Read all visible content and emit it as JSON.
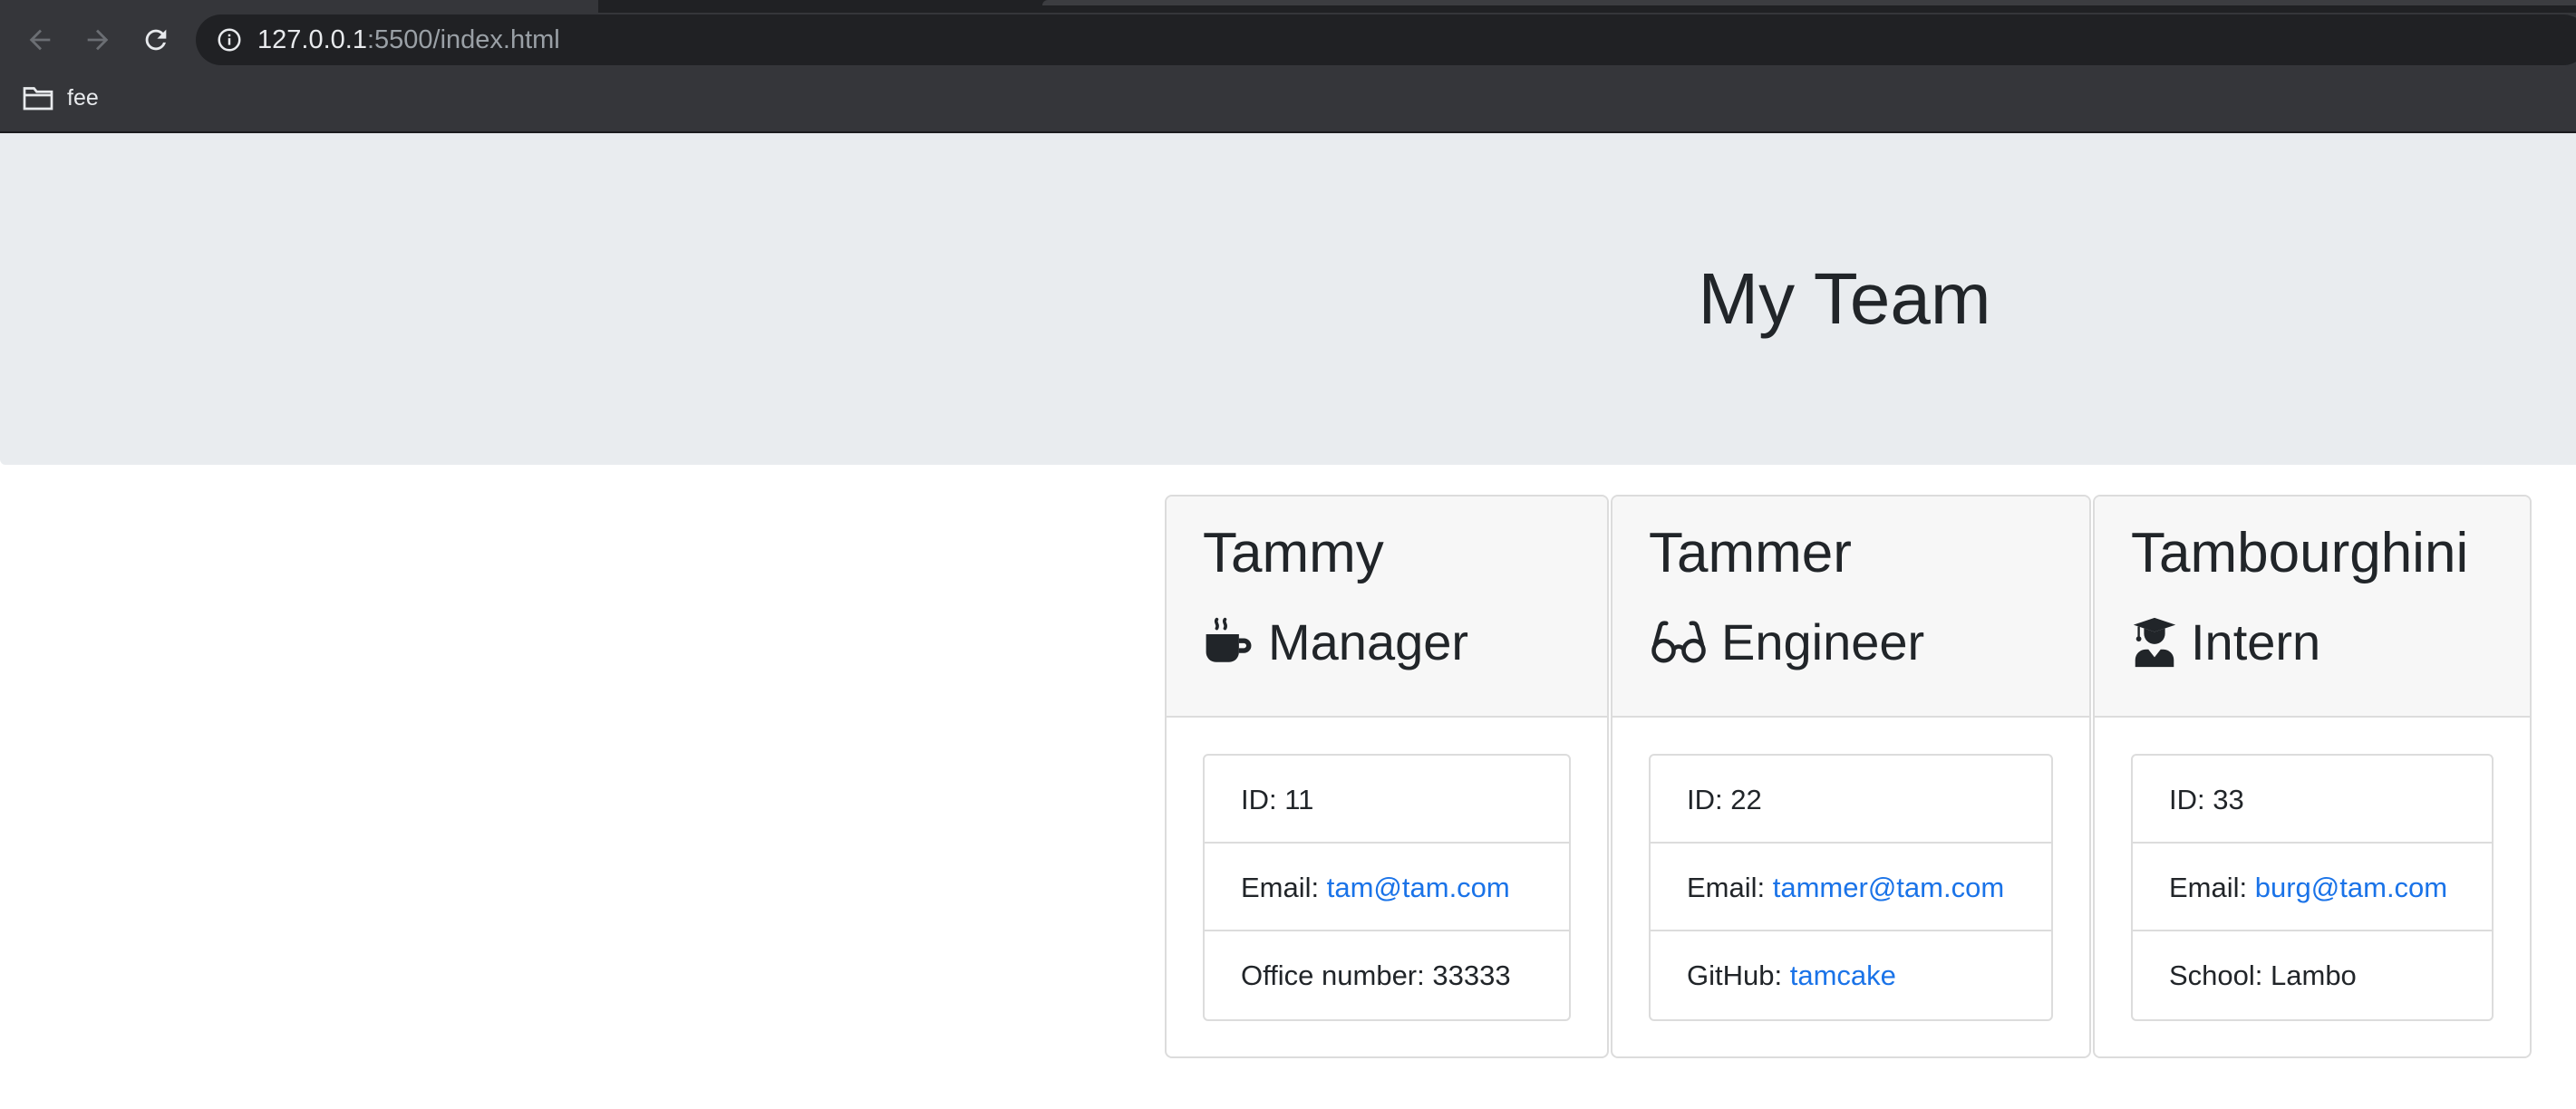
{
  "browser": {
    "url_host": "127.0.0.1",
    "url_rest": ":5500/index.html",
    "bookmark_label": "fee"
  },
  "page": {
    "title": "My Team"
  },
  "cards": [
    {
      "name": "Tammy",
      "role": "Manager",
      "icon": "mug-hot-icon",
      "id_label": "ID: 11",
      "email_prefix": "Email: ",
      "email": "tam@tam.com",
      "extra_prefix": "Office number: 33333",
      "extra_link": ""
    },
    {
      "name": "Tammer",
      "role": "Engineer",
      "icon": "glasses-icon",
      "id_label": "ID: 22",
      "email_prefix": "Email: ",
      "email": "tammer@tam.com",
      "extra_prefix": "GitHub: ",
      "extra_link": "tamcake"
    },
    {
      "name": "Tambourghini",
      "role": "Intern",
      "icon": "user-graduate-icon",
      "id_label": "ID: 33",
      "email_prefix": "Email: ",
      "email": "burg@tam.com",
      "extra_prefix": "School: Lambo",
      "extra_link": ""
    }
  ],
  "colors": {
    "link": "#1a73e8",
    "jumbotron": "#e9ecef",
    "card_header": "#f7f7f7"
  }
}
